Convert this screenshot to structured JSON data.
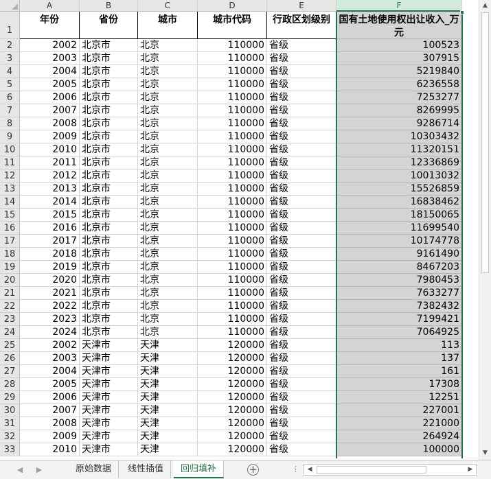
{
  "columns": [
    "A",
    "B",
    "C",
    "D",
    "E",
    "F"
  ],
  "header_row": {
    "row_number": "1",
    "cells": [
      "年份",
      "省份",
      "城市",
      "城市代码",
      "行政区划级别",
      "国有土地使用权出让收入_万元"
    ]
  },
  "rows": [
    {
      "n": "2",
      "year": "2002",
      "province": "北京市",
      "city": "北京",
      "code": "110000",
      "level": "省级",
      "income": "100523"
    },
    {
      "n": "3",
      "year": "2003",
      "province": "北京市",
      "city": "北京",
      "code": "110000",
      "level": "省级",
      "income": "307915"
    },
    {
      "n": "4",
      "year": "2004",
      "province": "北京市",
      "city": "北京",
      "code": "110000",
      "level": "省级",
      "income": "5219840"
    },
    {
      "n": "5",
      "year": "2005",
      "province": "北京市",
      "city": "北京",
      "code": "110000",
      "level": "省级",
      "income": "6236558"
    },
    {
      "n": "6",
      "year": "2006",
      "province": "北京市",
      "city": "北京",
      "code": "110000",
      "level": "省级",
      "income": "7253277"
    },
    {
      "n": "7",
      "year": "2007",
      "province": "北京市",
      "city": "北京",
      "code": "110000",
      "level": "省级",
      "income": "8269995"
    },
    {
      "n": "8",
      "year": "2008",
      "province": "北京市",
      "city": "北京",
      "code": "110000",
      "level": "省级",
      "income": "9286714"
    },
    {
      "n": "9",
      "year": "2009",
      "province": "北京市",
      "city": "北京",
      "code": "110000",
      "level": "省级",
      "income": "10303432"
    },
    {
      "n": "10",
      "year": "2010",
      "province": "北京市",
      "city": "北京",
      "code": "110000",
      "level": "省级",
      "income": "11320151"
    },
    {
      "n": "11",
      "year": "2011",
      "province": "北京市",
      "city": "北京",
      "code": "110000",
      "level": "省级",
      "income": "12336869"
    },
    {
      "n": "12",
      "year": "2012",
      "province": "北京市",
      "city": "北京",
      "code": "110000",
      "level": "省级",
      "income": "10013032"
    },
    {
      "n": "13",
      "year": "2013",
      "province": "北京市",
      "city": "北京",
      "code": "110000",
      "level": "省级",
      "income": "15526859"
    },
    {
      "n": "14",
      "year": "2014",
      "province": "北京市",
      "city": "北京",
      "code": "110000",
      "level": "省级",
      "income": "16838462"
    },
    {
      "n": "15",
      "year": "2015",
      "province": "北京市",
      "city": "北京",
      "code": "110000",
      "level": "省级",
      "income": "18150065"
    },
    {
      "n": "16",
      "year": "2016",
      "province": "北京市",
      "city": "北京",
      "code": "110000",
      "level": "省级",
      "income": "11699540"
    },
    {
      "n": "17",
      "year": "2017",
      "province": "北京市",
      "city": "北京",
      "code": "110000",
      "level": "省级",
      "income": "10174778"
    },
    {
      "n": "18",
      "year": "2018",
      "province": "北京市",
      "city": "北京",
      "code": "110000",
      "level": "省级",
      "income": "9161490"
    },
    {
      "n": "19",
      "year": "2019",
      "province": "北京市",
      "city": "北京",
      "code": "110000",
      "level": "省级",
      "income": "8467203"
    },
    {
      "n": "20",
      "year": "2020",
      "province": "北京市",
      "city": "北京",
      "code": "110000",
      "level": "省级",
      "income": "7980453"
    },
    {
      "n": "21",
      "year": "2021",
      "province": "北京市",
      "city": "北京",
      "code": "110000",
      "level": "省级",
      "income": "7633277"
    },
    {
      "n": "22",
      "year": "2022",
      "province": "北京市",
      "city": "北京",
      "code": "110000",
      "level": "省级",
      "income": "7382432"
    },
    {
      "n": "23",
      "year": "2023",
      "province": "北京市",
      "city": "北京",
      "code": "110000",
      "level": "省级",
      "income": "7199421"
    },
    {
      "n": "24",
      "year": "2024",
      "province": "北京市",
      "city": "北京",
      "code": "110000",
      "level": "省级",
      "income": "7064925"
    },
    {
      "n": "25",
      "year": "2002",
      "province": "天津市",
      "city": "天津",
      "code": "120000",
      "level": "省级",
      "income": "113"
    },
    {
      "n": "26",
      "year": "2003",
      "province": "天津市",
      "city": "天津",
      "code": "120000",
      "level": "省级",
      "income": "137"
    },
    {
      "n": "27",
      "year": "2004",
      "province": "天津市",
      "city": "天津",
      "code": "120000",
      "level": "省级",
      "income": "161"
    },
    {
      "n": "28",
      "year": "2005",
      "province": "天津市",
      "city": "天津",
      "code": "120000",
      "level": "省级",
      "income": "17308"
    },
    {
      "n": "29",
      "year": "2006",
      "province": "天津市",
      "city": "天津",
      "code": "120000",
      "level": "省级",
      "income": "12251"
    },
    {
      "n": "30",
      "year": "2007",
      "province": "天津市",
      "city": "天津",
      "code": "120000",
      "level": "省级",
      "income": "227001"
    },
    {
      "n": "31",
      "year": "2008",
      "province": "天津市",
      "city": "天津",
      "code": "120000",
      "level": "省级",
      "income": "221000"
    },
    {
      "n": "32",
      "year": "2009",
      "province": "天津市",
      "city": "天津",
      "code": "120000",
      "level": "省级",
      "income": "264924"
    },
    {
      "n": "33",
      "year": "2010",
      "province": "天津市",
      "city": "天津",
      "code": "120000",
      "level": "省级",
      "income": "100000"
    }
  ],
  "selected_column": "F",
  "sheet_tabs": [
    {
      "label": "原始数据",
      "active": false
    },
    {
      "label": "线性插值",
      "active": false
    },
    {
      "label": "回归填补",
      "active": true
    }
  ],
  "icons": {
    "prev_sheet": "triangle-left-icon",
    "next_sheet": "triangle-right-icon",
    "add_sheet": "plus-circle-icon",
    "more": "ellipsis-icon"
  },
  "colors": {
    "accent": "#217346",
    "selected_fill": "#d4d4d4",
    "header_fill": "#e6e6e6"
  }
}
